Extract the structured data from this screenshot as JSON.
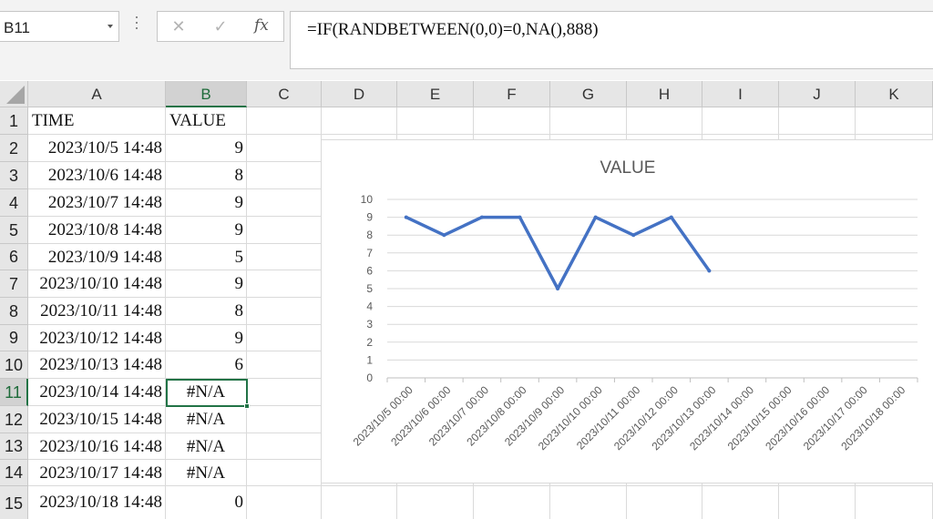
{
  "name_box": {
    "value": "B11"
  },
  "formula_bar": {
    "cancel_glyph": "✕",
    "enter_glyph": "✓",
    "fx_label": "fx",
    "formula": "=IF(RANDBETWEEN(0,0)=0,NA(),888)"
  },
  "columns": [
    "A",
    "B",
    "C",
    "D",
    "E",
    "F",
    "G",
    "H",
    "I",
    "J",
    "K"
  ],
  "selected_column": "B",
  "selected_row": "11",
  "rows": [
    {
      "num": "1",
      "a": "TIME",
      "b": "VALUE"
    },
    {
      "num": "2",
      "a": "2023/10/5 14:48",
      "b": "9"
    },
    {
      "num": "3",
      "a": "2023/10/6 14:48",
      "b": "8"
    },
    {
      "num": "4",
      "a": "2023/10/7 14:48",
      "b": "9"
    },
    {
      "num": "5",
      "a": "2023/10/8 14:48",
      "b": "9"
    },
    {
      "num": "6",
      "a": "2023/10/9 14:48",
      "b": "5"
    },
    {
      "num": "7",
      "a": "2023/10/10 14:48",
      "b": "9"
    },
    {
      "num": "8",
      "a": "2023/10/11 14:48",
      "b": "8"
    },
    {
      "num": "9",
      "a": "2023/10/12 14:48",
      "b": "9"
    },
    {
      "num": "10",
      "a": "2023/10/13 14:48",
      "b": "6"
    },
    {
      "num": "11",
      "a": "2023/10/14 14:48",
      "b": "#N/A"
    },
    {
      "num": "12",
      "a": "2023/10/15 14:48",
      "b": "#N/A"
    },
    {
      "num": "13",
      "a": "2023/10/16 14:48",
      "b": "#N/A"
    },
    {
      "num": "14",
      "a": "2023/10/17 14:48",
      "b": "#N/A"
    },
    {
      "num": "15",
      "a": "2023/10/18 14:48",
      "b": "0"
    }
  ],
  "chart_data": {
    "type": "line",
    "title": "VALUE",
    "xlabel": "",
    "ylabel": "",
    "ylim": [
      0,
      10
    ],
    "yticks": [
      0,
      1,
      2,
      3,
      4,
      5,
      6,
      7,
      8,
      9,
      10
    ],
    "grid": true,
    "legend": "none",
    "color": "#4472c4",
    "categories": [
      "2023/10/5 00:00",
      "2023/10/6 00:00",
      "2023/10/7 00:00",
      "2023/10/8 00:00",
      "2023/10/9 00:00",
      "2023/10/10 00:00",
      "2023/10/11 00:00",
      "2023/10/12 00:00",
      "2023/10/13 00:00",
      "2023/10/14 00:00",
      "2023/10/15 00:00",
      "2023/10/16 00:00",
      "2023/10/17 00:00",
      "2023/10/18 00:00"
    ],
    "series": [
      {
        "values": [
          9,
          8,
          9,
          9,
          5,
          9,
          8,
          9,
          6,
          null,
          null,
          null,
          null,
          null
        ]
      }
    ]
  }
}
